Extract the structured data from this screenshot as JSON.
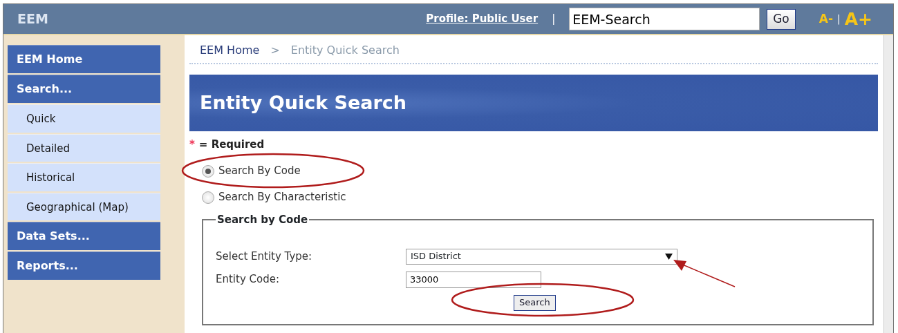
{
  "header": {
    "logo": "EEM",
    "profile_link": "Profile: Public User",
    "separator": "|",
    "search_value": "EEM-Search",
    "go_button": "Go",
    "font_smaller": "A-",
    "font_separator": "|",
    "font_larger": "A+"
  },
  "sidebar": {
    "items": [
      {
        "kind": "heading",
        "label": "EEM Home"
      },
      {
        "kind": "heading",
        "label": "Search..."
      },
      {
        "kind": "subitem",
        "label": "Quick"
      },
      {
        "kind": "subitem",
        "label": "Detailed"
      },
      {
        "kind": "subitem",
        "label": "Historical"
      },
      {
        "kind": "subitem",
        "label": "Geographical (Map)"
      },
      {
        "kind": "heading",
        "label": "Data Sets..."
      },
      {
        "kind": "heading",
        "label": "Reports..."
      }
    ]
  },
  "breadcrumb": [
    {
      "kind": "link",
      "label": "EEM Home"
    },
    {
      "kind": "separator",
      "label": ">"
    },
    {
      "kind": "current",
      "label": "Entity Quick Search"
    }
  ],
  "banner_title": "Entity Quick Search",
  "required_note": {
    "mark": "*",
    "text": "= Required"
  },
  "search_modes": [
    {
      "label": "Search By Code",
      "selected": true
    },
    {
      "label": "Search By Characteristic",
      "selected": false
    }
  ],
  "form": {
    "legend": "Search by Code",
    "fields": [
      {
        "kind": "select",
        "label": "Select Entity Type:",
        "value": "ISD District"
      },
      {
        "kind": "text",
        "label": "Entity Code:",
        "value": "33000"
      }
    ],
    "submit": "Search"
  }
}
